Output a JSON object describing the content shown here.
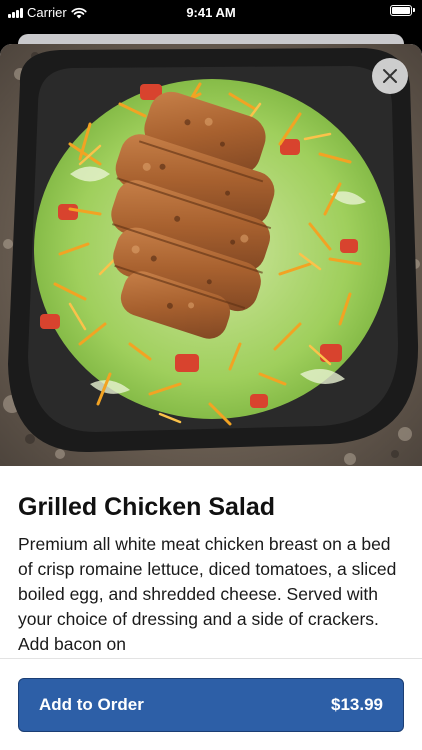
{
  "status_bar": {
    "carrier": "Carrier",
    "time": "9:41 AM"
  },
  "item": {
    "image_icon": "grilled-chicken-salad-photo",
    "title": "Grilled Chicken Salad",
    "description": "Premium all white meat chicken breast on a bed of crisp romaine lettuce, diced tomatoes, a sliced boiled egg, and shredded cheese. Served with your choice of dressing and a side of crackers.  Add bacon on"
  },
  "actions": {
    "add_label": "Add to Order",
    "price": "$13.99"
  },
  "colors": {
    "button": "#2d5fa7",
    "button_border": "#1b3e74"
  }
}
